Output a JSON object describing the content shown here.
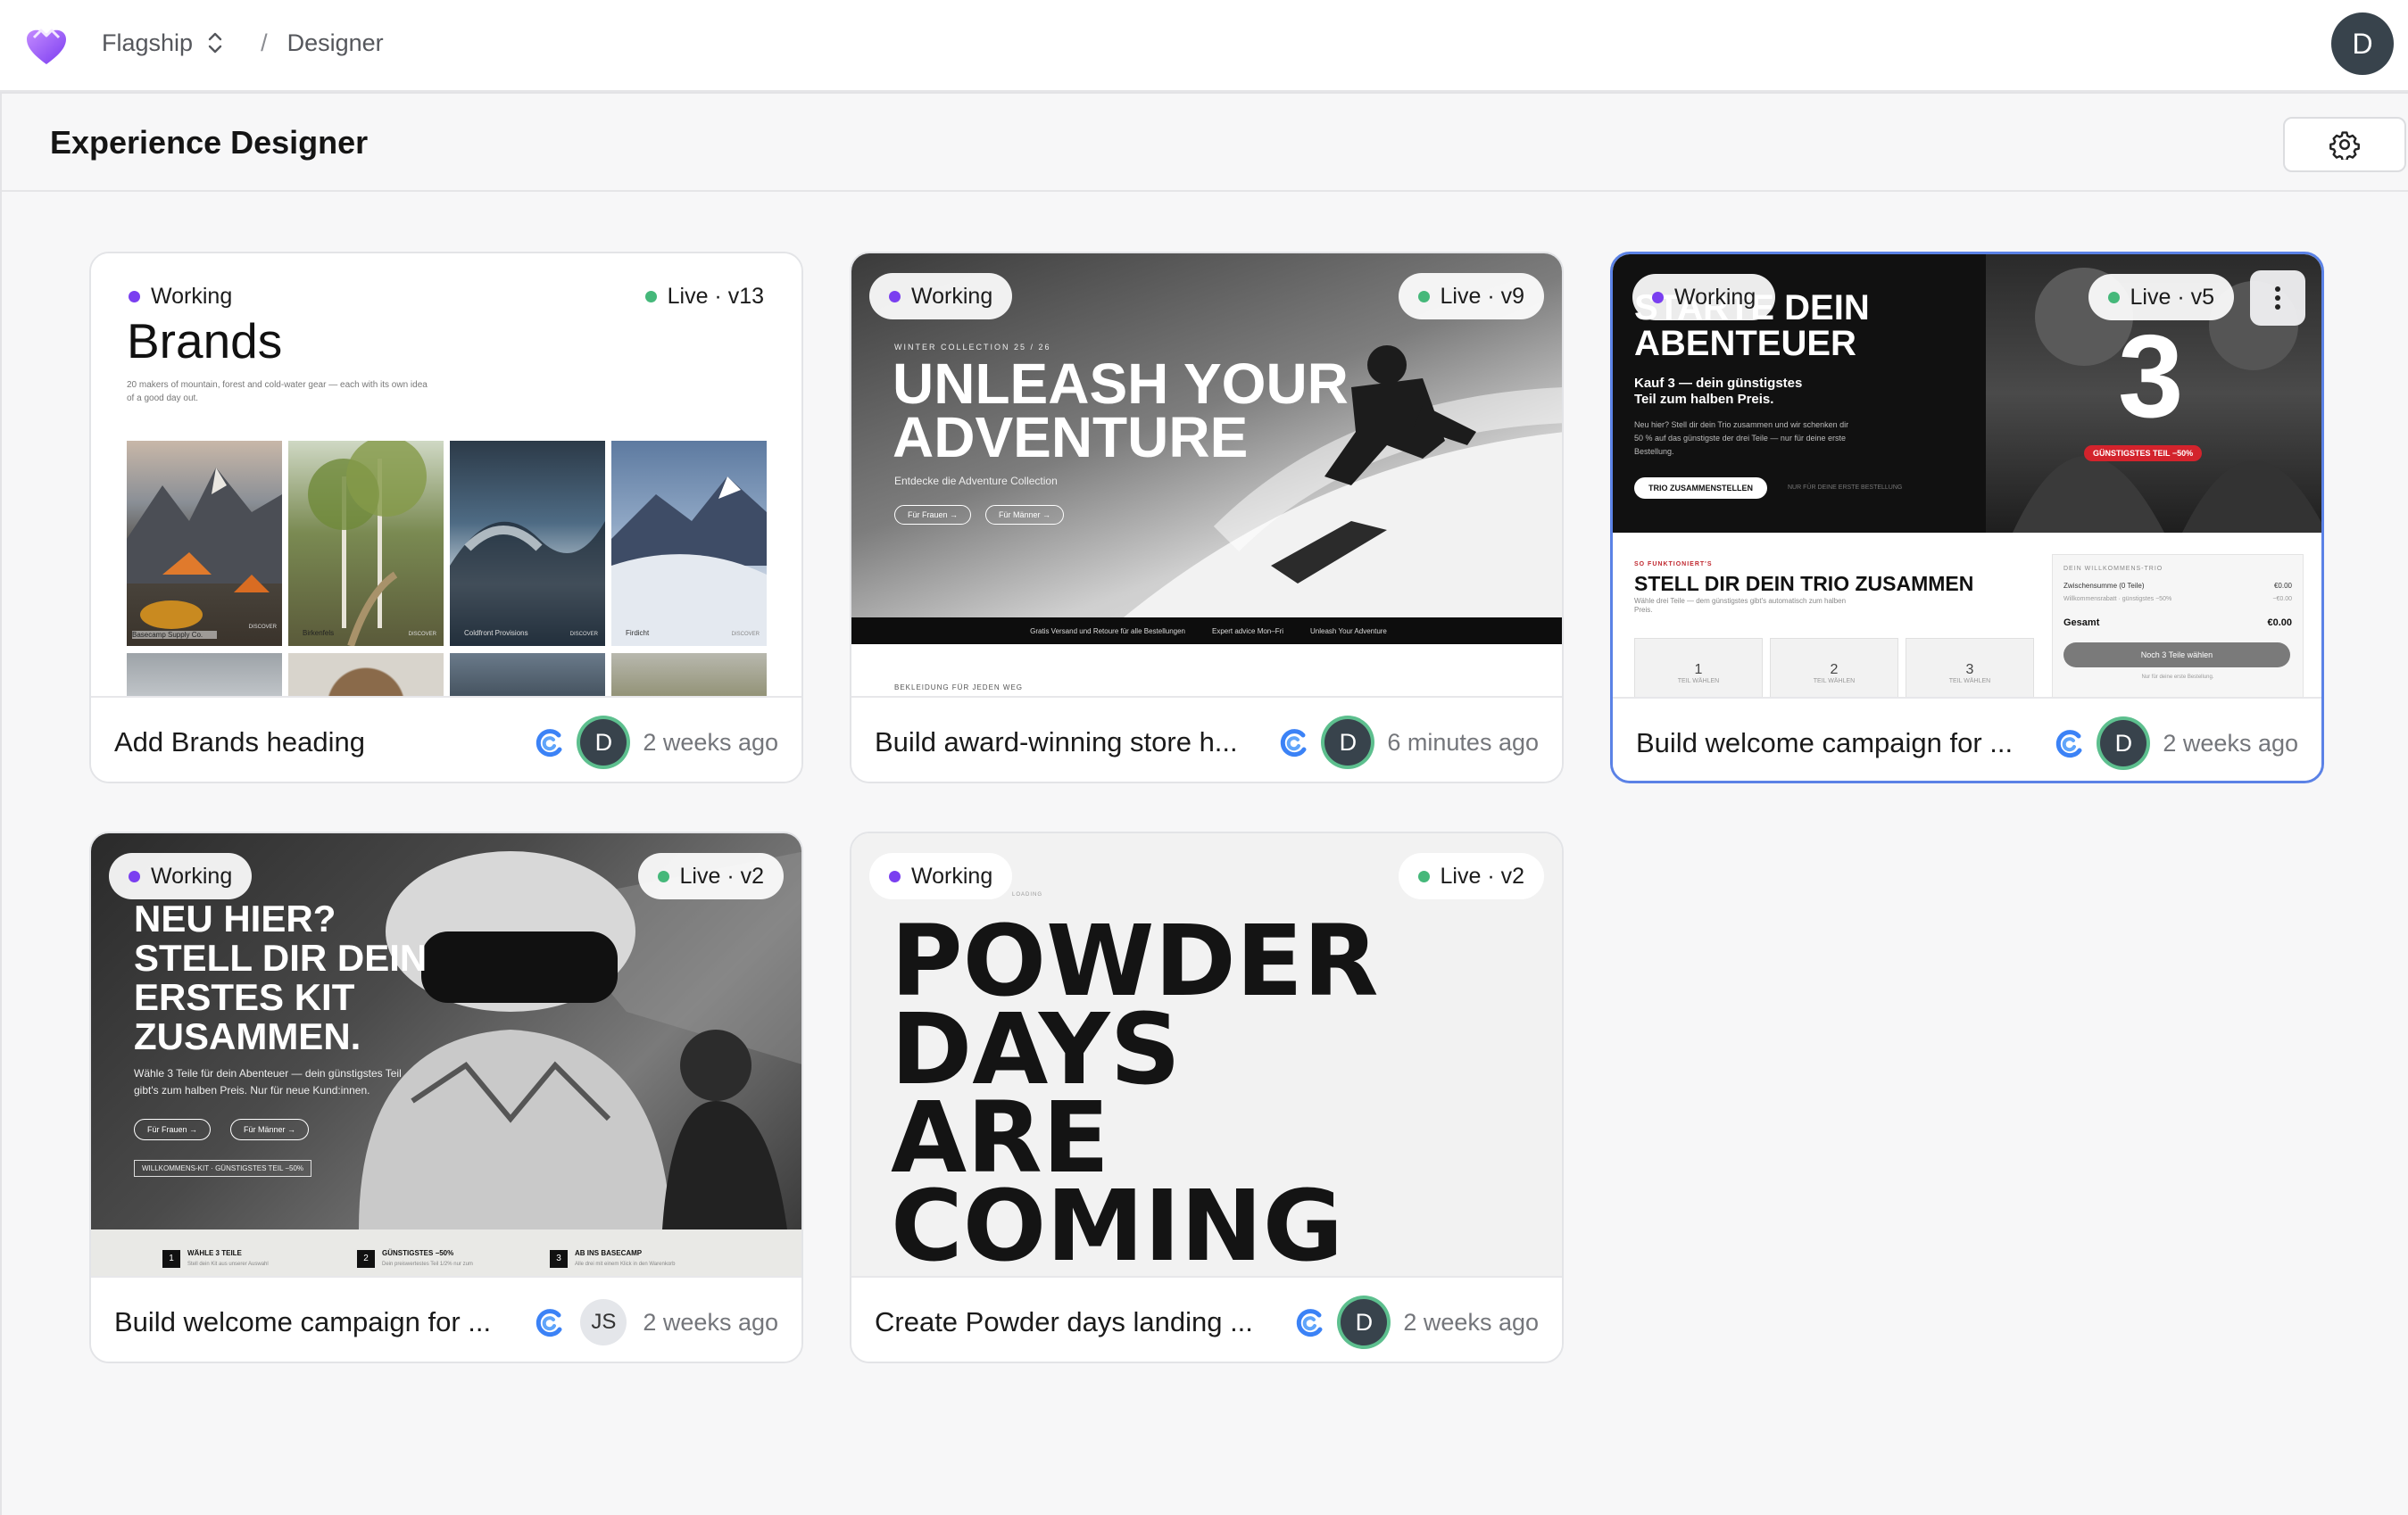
{
  "topbar": {
    "project": "Flagship",
    "separator": "/",
    "section": "Designer",
    "user_initial": "D"
  },
  "page": {
    "title": "Experience Designer"
  },
  "cards": [
    {
      "status": "Working",
      "live": "Live · v13",
      "title": "Add Brands heading",
      "avatar": "D",
      "time": "2 weeks ago",
      "preview": {
        "heading": "Brands",
        "subtext": "20 makers of mountain, forest and cold-water gear — each with its own idea of a good day out.",
        "tiles": [
          "Basecamp Supply Co.",
          "Birkenfels",
          "Coldfront Provisions",
          "Firdicht"
        ],
        "tile_tag": "DISCOVER"
      }
    },
    {
      "status": "Working",
      "live": "Live · v9",
      "title": "Build award-winning store h...",
      "avatar": "D",
      "time": "6 minutes ago",
      "preview": {
        "eyebrow": "WINTER COLLECTION 25 / 26",
        "headline_1": "UNLEASH YOUR",
        "headline_2": "ADVENTURE",
        "sub": "Entdecke die Adventure Collection",
        "btn_women": "Für Frauen →",
        "btn_men": "Für Männer →",
        "strip": [
          "Gratis Versand und Retoure für alle Bestellungen",
          "Expert advice Mon–Fri",
          "Unleash Your Adventure"
        ],
        "footer_label": "BEKLEIDUNG FÜR JEDEN WEG"
      }
    },
    {
      "status": "Working",
      "live": "Live · v5",
      "title": "Build welcome campaign for ...",
      "avatar": "D",
      "time": "2 weeks ago",
      "preview": {
        "headline_1": "STARTE DEIN",
        "headline_2": "ABENTEUER",
        "offer": "Kauf 3 — dein günstigstes Teil zum halben Preis.",
        "body": "Neu hier? Stell dir dein Trio zusammen und wir schenken dir 50 % auf das günstigste der drei Teile — nur für deine erste Bestellung.",
        "cta": "TRIO ZUSAMMENSTELLEN",
        "cta_note": "NUR FÜR DEINE ERSTE BESTELLUNG",
        "big_number": "3",
        "badge": "GÜNSTIGSTES TEIL −50%",
        "how_label": "SO FUNKTIONIERT'S",
        "how_title": "STELL DIR DEIN TRIO ZUSAMMEN",
        "how_sub": "Wähle drei Teile — dem günstigstes gibt's automatisch zum halben Preis.",
        "slots": [
          {
            "n": "1",
            "label": "TEIL WÄHLEN"
          },
          {
            "n": "2",
            "label": "TEIL WÄHLEN"
          },
          {
            "n": "3",
            "label": "TEIL WÄHLEN"
          }
        ],
        "summary_label": "DEIN WILLKOMMENS-TRIO",
        "subtotal_label": "Zwischensumme (0 Teile)",
        "subtotal_value": "€0.00",
        "discount_label": "Willkommensrabatt · günstigstes −50%",
        "discount_value": "−€0.00",
        "total_label": "Gesamt",
        "total_value": "€0.00",
        "summary_btn": "Noch 3 Teile wählen",
        "summary_note": "Nur für deine erste Bestellung."
      }
    },
    {
      "status": "Working",
      "live": "Live · v2",
      "title": "Build welcome campaign for ...",
      "avatar": "JS",
      "time": "2 weeks ago",
      "preview": {
        "headline": [
          "NEU HIER?",
          "STELL DIR DEIN",
          "ERSTES KIT",
          "ZUSAMMEN."
        ],
        "body": "Wähle 3 Teile für dein Abenteuer — dein günstigstes Teil gibt's zum halben Preis. Nur für neue Kund:innen.",
        "btn_women": "Für Frauen →",
        "btn_men": "Für Männer →",
        "tag": "WILLKOMMENS-KIT · GÜNSTIGSTES TEIL −50%",
        "steps": [
          {
            "n": "1",
            "title": "WÄHLE 3 TEILE",
            "sub": "Stell dein Kit aus unserer Auswahl"
          },
          {
            "n": "2",
            "title": "GÜNSTIGSTES −50%",
            "sub": "Dein preiswertestes Teil 1/2% nur zum"
          },
          {
            "n": "3",
            "title": "AB INS BASECAMP",
            "sub": "Alle drei mit einem Klick in den Warenkorb"
          }
        ]
      }
    },
    {
      "status": "Working",
      "live": "Live · v2",
      "title": "Create Powder days landing ...",
      "avatar": "D",
      "time": "2 weeks ago",
      "preview": {
        "eyebrow": "LOADING",
        "headline": [
          "POWDER",
          "DAYS",
          "ARE",
          "COMING"
        ]
      }
    }
  ]
}
